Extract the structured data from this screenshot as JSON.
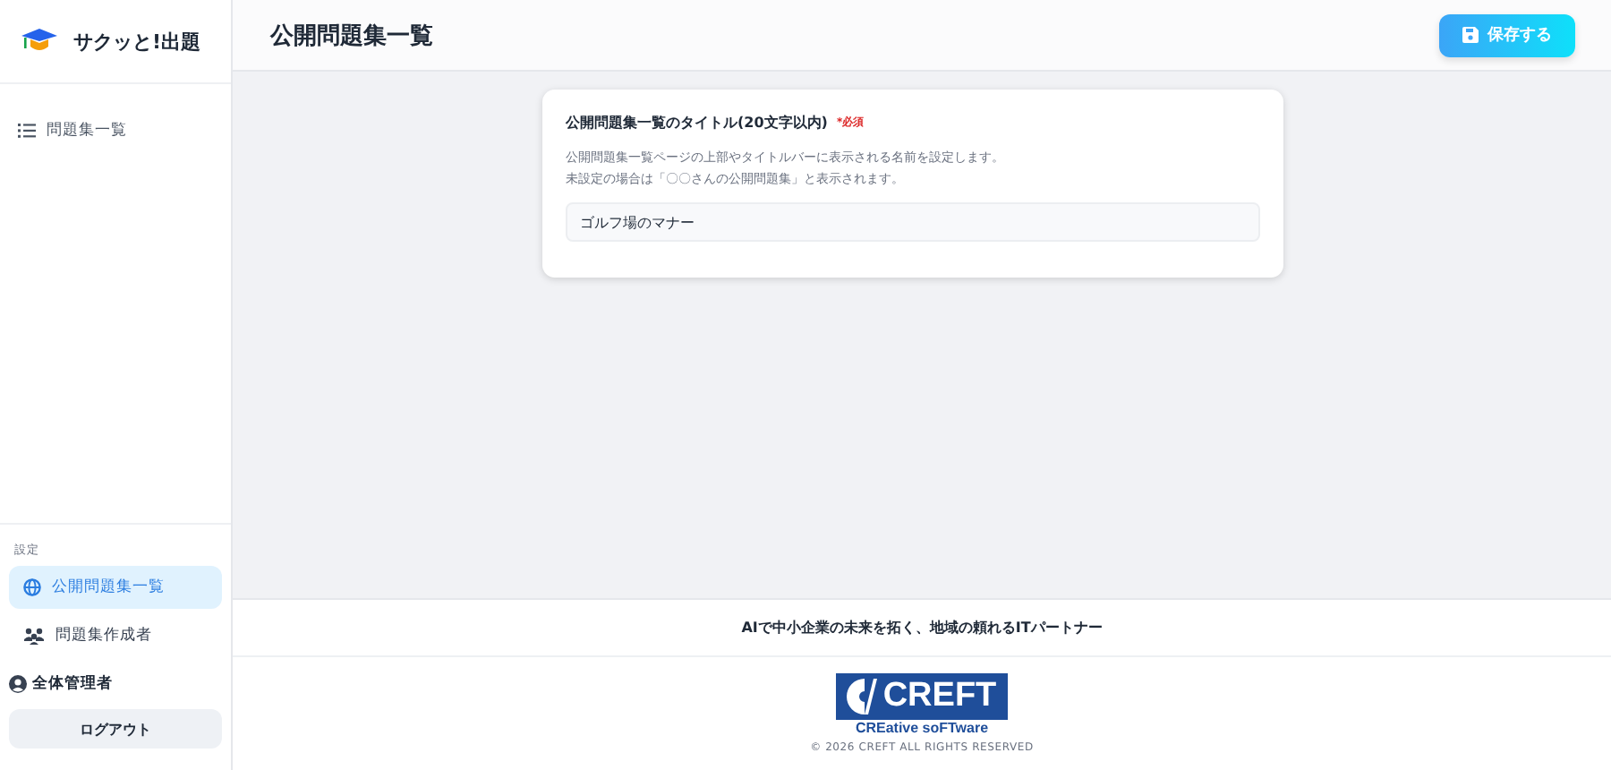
{
  "app": {
    "name": "サクッと!出題"
  },
  "sidebar": {
    "items": [
      {
        "label": "問題集一覧",
        "selected": false
      }
    ],
    "settings_label": "設定",
    "settings_items": [
      {
        "label": "公開問題集一覧",
        "selected": true,
        "kind": "globe"
      },
      {
        "label": "問題集作成者",
        "selected": false,
        "kind": "users"
      }
    ],
    "user": "全体管理者",
    "logout": "ログアウト"
  },
  "header": {
    "title": "公開問題集一覧",
    "save_button": "保存する"
  },
  "form": {
    "label": "公開問題集一覧のタイトル(20文字以内)",
    "required": "*必須",
    "help": [
      "公開問題集一覧ページの上部やタイトルバーに表示される名前を設定します。",
      "未設定の場合は「〇〇さんの公開問題集」と表示されます。"
    ],
    "value": "ゴルフ場のマナー"
  },
  "footer": {
    "tagline": "AIで中小企業の未来を拓く、地域の頼れるITパートナー",
    "logo": "CREFT",
    "logo_sub": "CREative soFTware",
    "copyright": "© 2026 CREFT ALL RIGHTS RESERVED"
  }
}
